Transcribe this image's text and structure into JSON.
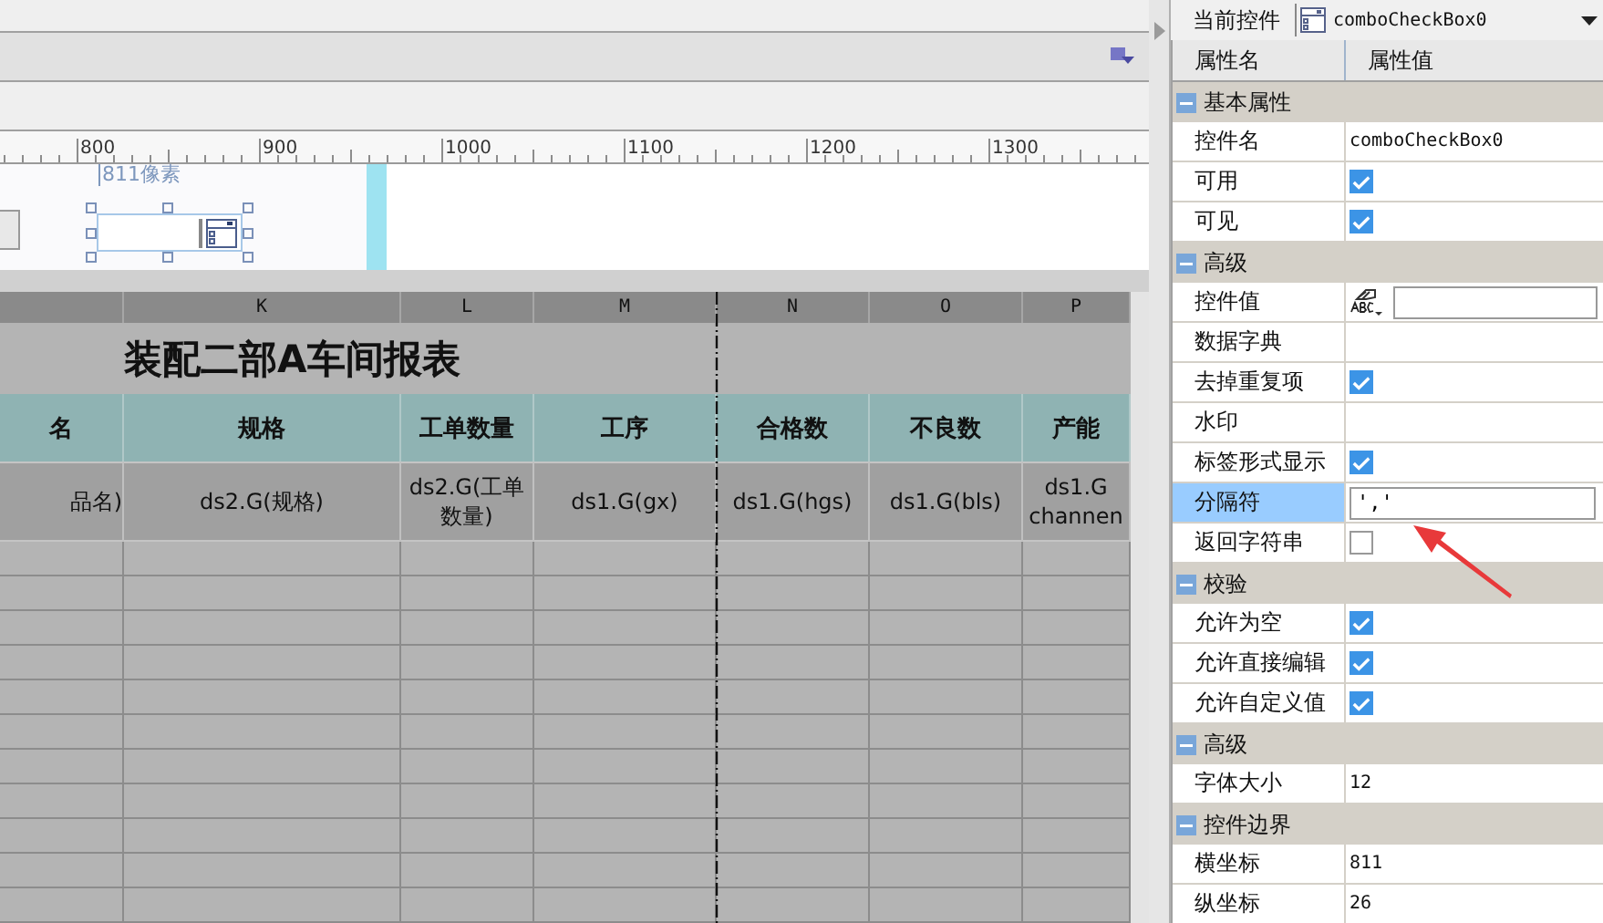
{
  "ruler": {
    "labels": [
      "800",
      "900",
      "1000",
      "1100",
      "1200",
      "1300"
    ]
  },
  "canvas": {
    "size_label": "811像素"
  },
  "sheet": {
    "column_letters": [
      "K",
      "L",
      "M",
      "N",
      "O",
      "P"
    ],
    "title": "装配二部A车间报表",
    "headers": [
      "名",
      "规格",
      "工单数量",
      "工序",
      "合格数",
      "不良数",
      "产能"
    ],
    "data_row": [
      "品名)",
      "ds2.G(规格)",
      "ds2.G(工单数量)",
      "ds1.G(gx)",
      "ds1.G(hgs)",
      "ds1.G(bls)",
      "ds1.G channen"
    ]
  },
  "properties": {
    "current_label": "当前控件",
    "current_value": "comboCheckBox0",
    "columns": [
      "属性名",
      "属性值"
    ],
    "sections": [
      {
        "title": "基本属性",
        "expanded": true,
        "items": [
          {
            "name": "控件名",
            "kind": "text",
            "value": "comboCheckBox0",
            "selected": false
          },
          {
            "name": "可用",
            "kind": "check",
            "checked": true,
            "selected": false
          },
          {
            "name": "可见",
            "kind": "check",
            "checked": true,
            "selected": false
          }
        ]
      },
      {
        "title": "高级",
        "expanded": true,
        "items": [
          {
            "name": "控件值",
            "kind": "expr",
            "selected": false
          },
          {
            "name": "数据字典",
            "kind": "empty",
            "selected": false
          },
          {
            "name": "去掉重复项",
            "kind": "check",
            "checked": true,
            "selected": false
          },
          {
            "name": "水印",
            "kind": "empty",
            "selected": false
          },
          {
            "name": "标签形式显示",
            "kind": "check",
            "checked": true,
            "selected": false
          },
          {
            "name": "分隔符",
            "kind": "input",
            "value": "','",
            "selected": true
          },
          {
            "name": "返回字符串",
            "kind": "check",
            "checked": false,
            "selected": false
          }
        ]
      },
      {
        "title": "校验",
        "expanded": true,
        "items": [
          {
            "name": "允许为空",
            "kind": "check",
            "checked": true,
            "selected": false
          },
          {
            "name": "允许直接编辑",
            "kind": "check",
            "checked": true,
            "selected": false
          },
          {
            "name": "允许自定义值",
            "kind": "check",
            "checked": true,
            "selected": false
          }
        ]
      },
      {
        "title": "高级",
        "expanded": true,
        "items": [
          {
            "name": "字体大小",
            "kind": "text",
            "value": "12",
            "selected": false
          }
        ]
      },
      {
        "title": "控件边界",
        "expanded": true,
        "items": [
          {
            "name": "横坐标",
            "kind": "text",
            "value": "811",
            "selected": false
          },
          {
            "name": "纵坐标",
            "kind": "text",
            "value": "26",
            "selected": false
          }
        ]
      }
    ]
  }
}
